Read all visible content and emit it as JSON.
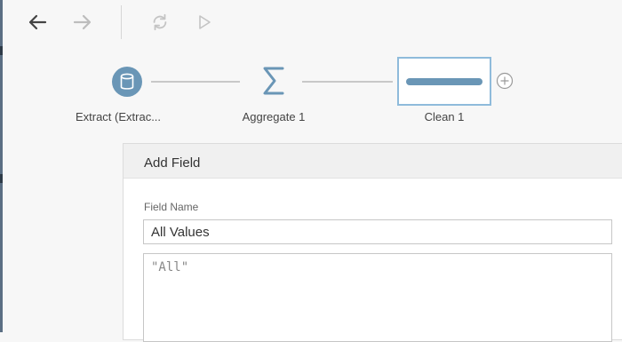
{
  "toolbar": {
    "back_icon": "arrow-left-icon",
    "forward_icon": "arrow-right-icon",
    "refresh_icon": "refresh-icon",
    "run_icon": "play-icon"
  },
  "flow": {
    "nodes": [
      {
        "label": "Extract (Extrac...",
        "icon": "database-icon"
      },
      {
        "label": "Aggregate 1",
        "icon": "sigma-icon"
      },
      {
        "label": "Clean 1",
        "icon": "clean-step-icon"
      }
    ],
    "add_icon": "plus-circle-icon"
  },
  "panel": {
    "title": "Add Field",
    "field_name_label": "Field Name",
    "field_name_value": "All Values",
    "formula": "\"All\""
  },
  "colors": {
    "accent": "#6a96b6",
    "selection_border": "#8fbbdb",
    "sidebar_edge": "#5b6f84"
  }
}
